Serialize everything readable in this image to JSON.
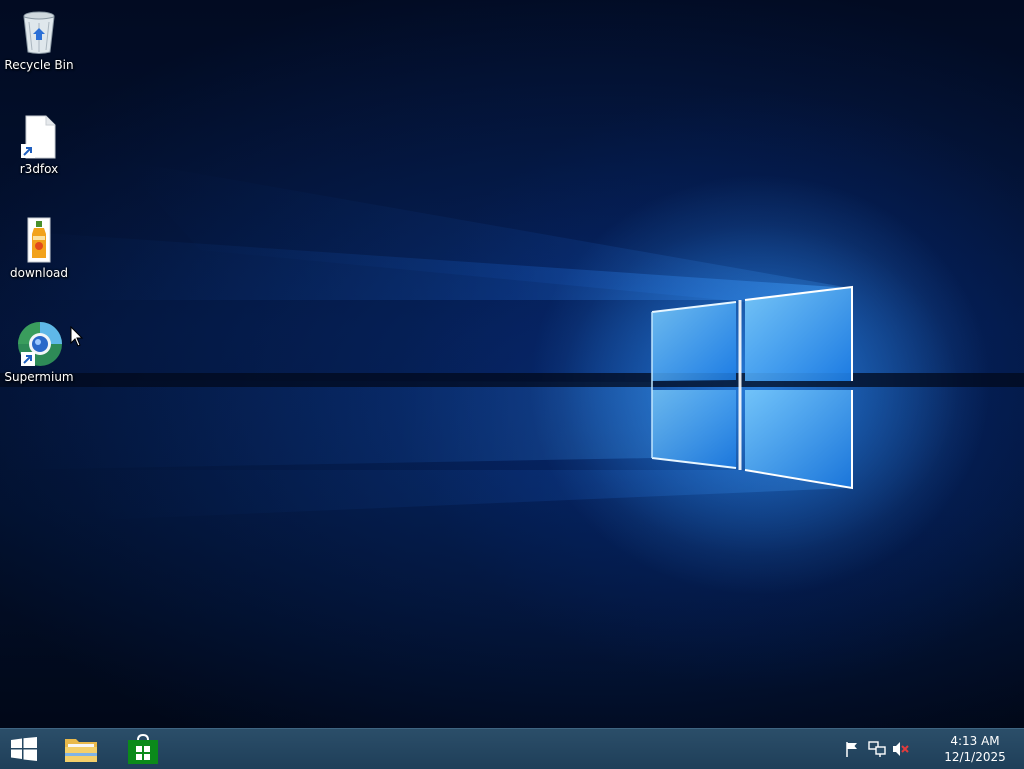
{
  "desktop": {
    "icons": [
      {
        "label": "Recycle Bin",
        "icon": "recycle-bin-icon"
      },
      {
        "label": "r3dfox",
        "icon": "document-shortcut-icon"
      },
      {
        "label": "download",
        "icon": "juice-bottle-file-icon"
      },
      {
        "label": "Supermium",
        "icon": "supermium-browser-icon"
      }
    ]
  },
  "taskbar": {
    "pinned": [
      {
        "name": "Start",
        "icon": "windows-logo-icon"
      },
      {
        "name": "File Explorer",
        "icon": "folder-icon"
      },
      {
        "name": "Store",
        "icon": "store-bag-icon"
      }
    ],
    "tray": {
      "icons": [
        "action-center-flag-icon",
        "network-icon",
        "volume-muted-icon"
      ],
      "time": "4:13 AM",
      "date": "12/1/2025"
    }
  },
  "colors": {
    "taskbar": "#1f3f59",
    "accent": "#1e90ff",
    "store_green": "#0b8a1a"
  }
}
